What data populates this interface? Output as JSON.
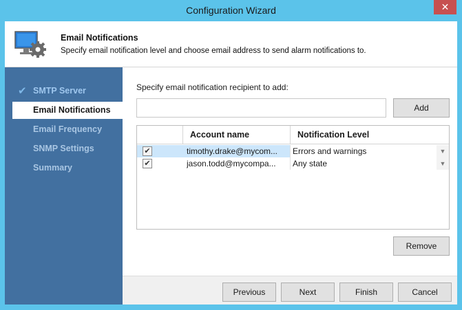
{
  "window": {
    "title": "Configuration Wizard",
    "close_glyph": "✕"
  },
  "header": {
    "icon": "monitor-gear-icon",
    "title": "Email Notifications",
    "subtitle": "Specify email notification level and choose email address to send alarm notifications to."
  },
  "sidebar": {
    "items": [
      {
        "label": "SMTP Server",
        "state": "done"
      },
      {
        "label": "Email Notifications",
        "state": "active"
      },
      {
        "label": "Email Frequency",
        "state": "pending"
      },
      {
        "label": "SNMP Settings",
        "state": "pending"
      },
      {
        "label": "Summary",
        "state": "pending"
      }
    ],
    "check_glyph": "✔"
  },
  "main": {
    "prompt": "Specify email notification recipient to add:",
    "email_input": {
      "value": "",
      "placeholder": ""
    },
    "add_label": "Add",
    "remove_label": "Remove",
    "table": {
      "columns": [
        "",
        "Account name",
        "Notification Level"
      ],
      "rows": [
        {
          "checked": true,
          "account": "timothy.drake@mycom...",
          "level": "Errors and warnings"
        },
        {
          "checked": true,
          "account": "jason.todd@mycompa...",
          "level": "Any state"
        }
      ],
      "check_glyph": "✔",
      "dropdown_glyph": "▼"
    }
  },
  "footer": {
    "previous_label": "Previous",
    "next_label": "Next",
    "finish_label": "Finish",
    "cancel_label": "Cancel"
  },
  "colors": {
    "title_bar": "#5bc3ea",
    "sidebar": "#4270a0",
    "close_button": "#c75050",
    "selected_row": "#cce6fb"
  }
}
